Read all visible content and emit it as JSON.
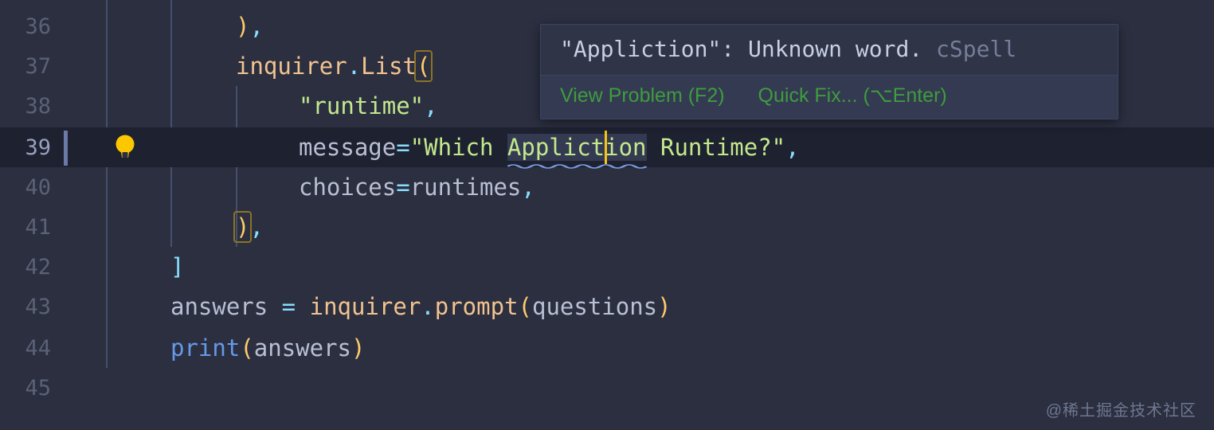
{
  "editor": {
    "language": "python",
    "background": "#2b2f40",
    "active_line_background": "#1e2130",
    "line_number_color": "#5b6176",
    "active_line_number_color": "#97a0bd",
    "lines": [
      {
        "number": "36",
        "text": "),"
      },
      {
        "number": "37",
        "text": "inquirer.List("
      },
      {
        "number": "38",
        "text": "\"runtime\","
      },
      {
        "number": "39",
        "text": "message=\"Which Appliction Runtime?\","
      },
      {
        "number": "40",
        "text": "choices=runtimes,"
      },
      {
        "number": "41",
        "text": "),"
      },
      {
        "number": "42",
        "text": "]"
      },
      {
        "number": "43",
        "text": "answers = inquirer.prompt(questions)"
      },
      {
        "number": "44",
        "text": "print(answers)"
      },
      {
        "number": "45",
        "text": ""
      }
    ],
    "tokens": {
      "l36_paren": ")",
      "l36_comma": ",",
      "l37_obj": "inquirer",
      "l37_dot": ".",
      "l37_method": "List",
      "l37_open": "(",
      "l38_str": "\"runtime\"",
      "l38_comma": ",",
      "l39_name": "message",
      "l39_eq": "=",
      "l39_quote_open": "\"",
      "l39_str_a": "Which ",
      "l39_misspelled": "Appliction",
      "l39_str_b": " Runtime?",
      "l39_quote_close": "\"",
      "l39_comma": ",",
      "l40_name": "choices",
      "l40_eq": "=",
      "l40_value": "runtimes",
      "l40_comma": ",",
      "l41_paren": ")",
      "l41_comma": ",",
      "l42_bracket": "]",
      "l43_var": "answers",
      "l43_eq": " = ",
      "l43_obj": "inquirer",
      "l43_dot": ".",
      "l43_method": "prompt",
      "l43_open": "(",
      "l43_arg": "questions",
      "l43_close": ")",
      "l44_kw": "print",
      "l44_open": "(",
      "l44_arg": "answers",
      "l44_close": ")"
    },
    "gutter": {
      "lightbulb_icon": "lightbulb-quickfix-icon",
      "lightbulb_color": "#fdc700"
    },
    "caret": {
      "color": "#f5c518",
      "line": "39"
    },
    "diagnostic": {
      "squiggle_color": "#7a9ce0",
      "word_highlight_color": "#343a52"
    },
    "bracket_match_color": "#8a7424"
  },
  "hover": {
    "message_quoted": "\"Appliction\"",
    "message_rest": ": Unknown word.",
    "source": "cSpell",
    "actions": [
      {
        "label": "View Problem (F2)"
      },
      {
        "label": "Quick Fix... (⌥Enter)"
      }
    ],
    "link_color": "#3f9c3f",
    "background": "#2f3447",
    "footer_background": "#333a51",
    "border_color": "#3e4561"
  },
  "watermark": {
    "text": "@稀土掘金技术社区"
  }
}
